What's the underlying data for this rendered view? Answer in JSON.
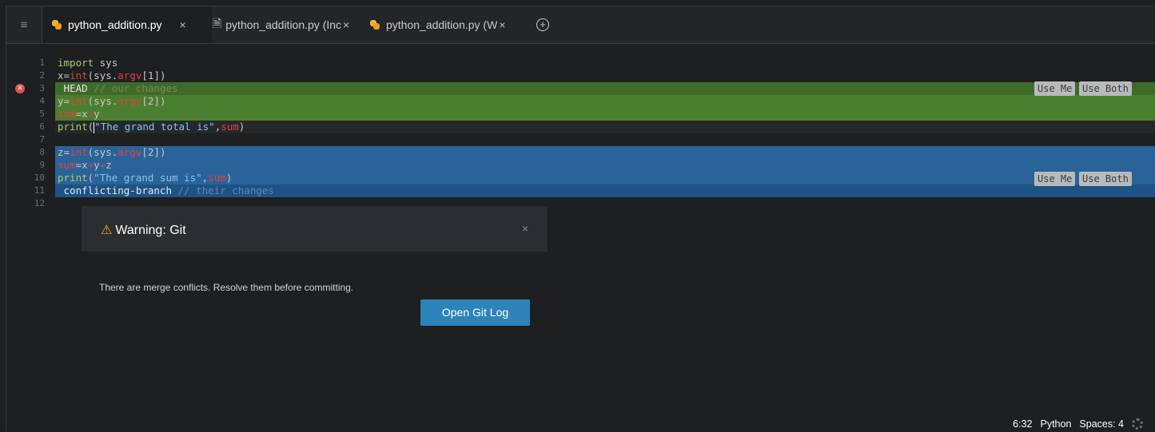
{
  "tabs": [
    {
      "label": "python_addition.py",
      "close": "×"
    },
    {
      "label": "python_addition.py (Inc",
      "close": "×"
    },
    {
      "label": "python_addition.py (W",
      "close": "×"
    }
  ],
  "hamburger": "≡",
  "add_tab": "+",
  "doc_glyph": "🗎",
  "line_numbers": [
    "1",
    "2",
    "3",
    "4",
    "5",
    "6",
    "7",
    "8",
    "9",
    "10",
    "11",
    "12"
  ],
  "code": {
    "l1_kw": "import",
    "l1_rest": " sys",
    "l2_a": "x=",
    "l2_fn": "int",
    "l2_b": "(sys.",
    "l2_red": "argv",
    "l2_c": "[1])",
    "l3_head": " HEAD",
    "l3_comment": " // our changes",
    "l4_a": "y=",
    "l4_fn": "int",
    "l4_b": "(sys.",
    "l4_red": "argv",
    "l4_c": "[2])",
    "l5_red": "sum",
    "l5_a": "=x",
    "l5_red2": "+",
    "l5_b": "y",
    "l6_fn": "print",
    "l6_a": "(",
    "l6_str": "\"The grand total is\"",
    "l6_b": ",",
    "l6_red": "sum",
    "l6_c": ")",
    "l8_a": "z=",
    "l8_fn": "int",
    "l8_b": "(sys.",
    "l8_red": "argv",
    "l8_c": "[2])",
    "l9_red": "sum",
    "l9_a": "=x",
    "l9_red2": "+",
    "l9_b": "y",
    "l9_red3": "+",
    "l9_c": "z",
    "l10_fn": "print",
    "l10_a": "(",
    "l10_str": "\"The grand sum is\"",
    "l10_b": ",",
    "l10_red": "sum",
    "l10_c": ")",
    "l11_branch": " conflicting-branch",
    "l11_comment": " // their changes"
  },
  "conflict_buttons": {
    "use_me": "Use Me",
    "use_both": "Use Both"
  },
  "error_glyph": "✕",
  "dialog": {
    "warn_glyph": "⚠",
    "title": "Warning: Git",
    "close": "×",
    "message": "There are merge conflicts. Resolve them before committing.",
    "button": "Open Git Log"
  },
  "status": {
    "cursor": "6:32",
    "language": "Python",
    "spaces": "Spaces: 4"
  }
}
